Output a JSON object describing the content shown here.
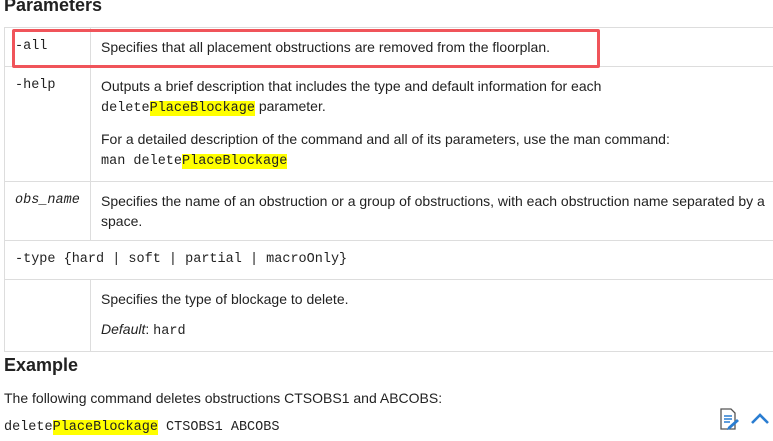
{
  "parameters_heading": "Parameters",
  "rows": [
    {
      "name": "-all",
      "desc": "Specifies that all placement obstructions are removed from the floorplan."
    },
    {
      "name": "-help",
      "desc1": "Outputs a brief description that includes the type and default information for each",
      "code1": "delete",
      "code1_hl": "PlaceBlockage",
      "desc1_tail": " parameter.",
      "desc2": "For a detailed description of the command and all of its parameters, use the man command:",
      "code2": "man delete",
      "code2_hl": "PlaceBlockage"
    },
    {
      "name": "obs_name",
      "desc": "Specifies the name of an obstruction or a group of obstructions, with each obstruction name separated by a space."
    },
    {
      "name": "-type {hard | soft | partial | macroOnly}"
    },
    {
      "desc": "Specifies the type of blockage to delete.",
      "default_label": "Default",
      "default_sep": ": ",
      "default_value": "hard"
    }
  ],
  "example_heading": "Example",
  "example_text": "The following command deletes obstructions CTSOBS1 and ABCOBS:",
  "example_code_pre": "delete",
  "example_code_hl": "PlaceBlockage",
  "example_code_post": " CTSOBS1 ABCOBS",
  "icons": [
    "feedback-document-icon",
    "back-to-top-chevron-icon"
  ],
  "colors": {
    "highlight": "#ffff00",
    "annotation_box": "#f0545a",
    "accent": "#2a7dd1"
  }
}
